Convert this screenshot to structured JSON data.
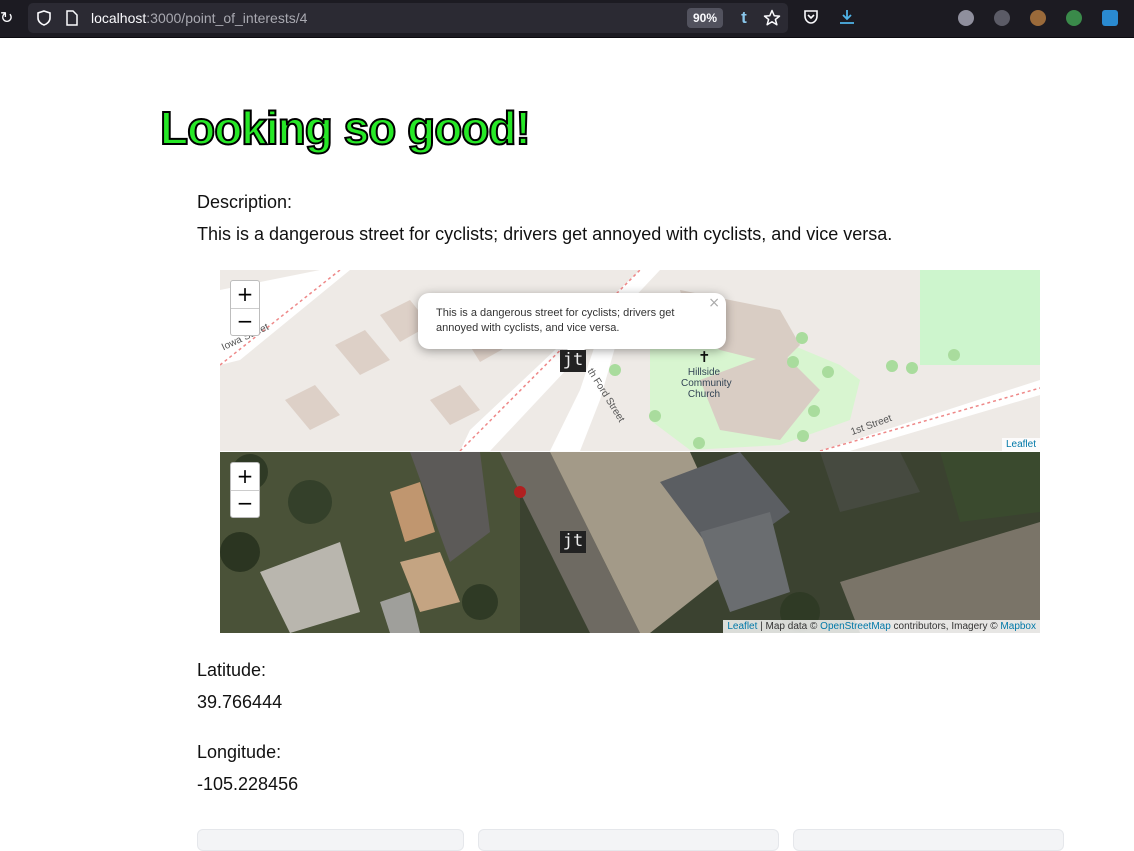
{
  "browser": {
    "url_host": "localhost",
    "url_path": ":3000/point_of_interests/4",
    "zoom": "90%",
    "tumblr_label": "t"
  },
  "page": {
    "title": "Looking so good!",
    "description_label": "Description:",
    "description": "This is a dangerous street for cyclists; drivers get annoyed with cyclists, and vice versa.",
    "latitude_label": "Latitude:",
    "latitude": "39.766444",
    "longitude_label": "Longitude:",
    "longitude": "-105.228456"
  },
  "map": {
    "zoom_in": "+",
    "zoom_out": "−",
    "marker_label": "jt",
    "popup_text": "This is a dangerous street for cyclists; drivers get annoyed with cyclists, and vice versa.",
    "popup_close": "×",
    "street_labels": [
      "Iowa Street",
      "th Ford Street",
      "1st Street"
    ],
    "poi_label_line1": "Hillside",
    "poi_label_line2": "Community",
    "poi_label_line3": "Church",
    "attribution_top": "Leaflet",
    "attribution_bottom": {
      "leaflet": "Leaflet",
      "sep": " | Map data © ",
      "osm": "OpenStreetMap",
      "mid": " contributors, Imagery © ",
      "mapbox": "Mapbox"
    }
  },
  "colors": {
    "title_fill": "#27e827",
    "title_stroke": "#000000",
    "chrome_bg": "#1c1b22",
    "link": "#0078a8"
  }
}
